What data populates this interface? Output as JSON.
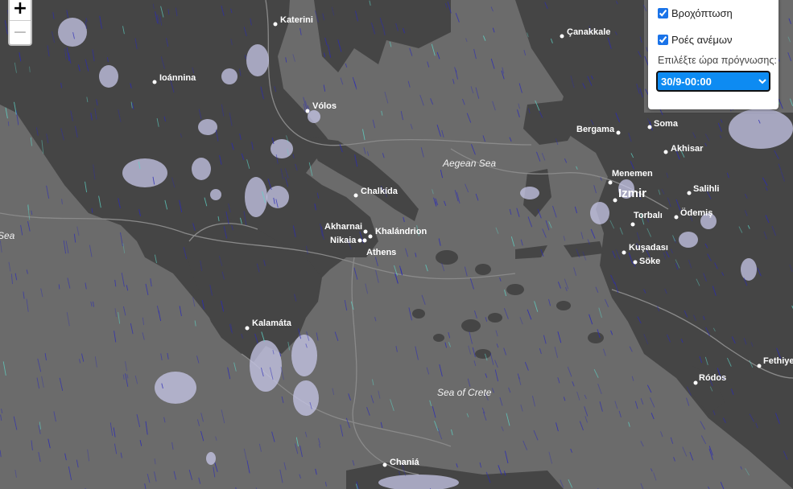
{
  "zoom": {
    "in_label": "+",
    "out_label": "−"
  },
  "panel": {
    "layers": [
      {
        "label": "Βροχόπτωση",
        "checked": true
      },
      {
        "label": "Ροές ανέμων",
        "checked": true
      }
    ],
    "forecast_label": "Επιλέξτε ώρα πρόγνωσης:",
    "forecast_selected": "30/9-00:00"
  },
  "map": {
    "cities": [
      {
        "name": "Katerini"
      },
      {
        "name": "Ioánnina"
      },
      {
        "name": "Vólos"
      },
      {
        "name": "Chalkída"
      },
      {
        "name": "Akharnai"
      },
      {
        "name": "Khalándrion"
      },
      {
        "name": "Nikaia"
      },
      {
        "name": "Athens"
      },
      {
        "name": "Kalamáta"
      },
      {
        "name": "Chaniá"
      },
      {
        "name": "Çanakkale"
      },
      {
        "name": "Bergama"
      },
      {
        "name": "Soma"
      },
      {
        "name": "Akhisar"
      },
      {
        "name": "Menemen"
      },
      {
        "name": "Izmir"
      },
      {
        "name": "Salihli"
      },
      {
        "name": "Torbalı"
      },
      {
        "name": "Ödemiş"
      },
      {
        "name": "Kuşadası"
      },
      {
        "name": "Söke"
      },
      {
        "name": "Ródos"
      },
      {
        "name": "Fethiye"
      }
    ],
    "seas": [
      {
        "name": "Aegean Sea"
      },
      {
        "name": "Sea of Crete"
      },
      {
        "name": "Sea"
      }
    ],
    "colors": {
      "sea": "#6b6b6b",
      "land": "#454545",
      "rain": "#c7c7e8",
      "wind": "#2a2ab8",
      "wind_alt": "#5fd6c8",
      "accent": "#0d8bf2"
    }
  }
}
